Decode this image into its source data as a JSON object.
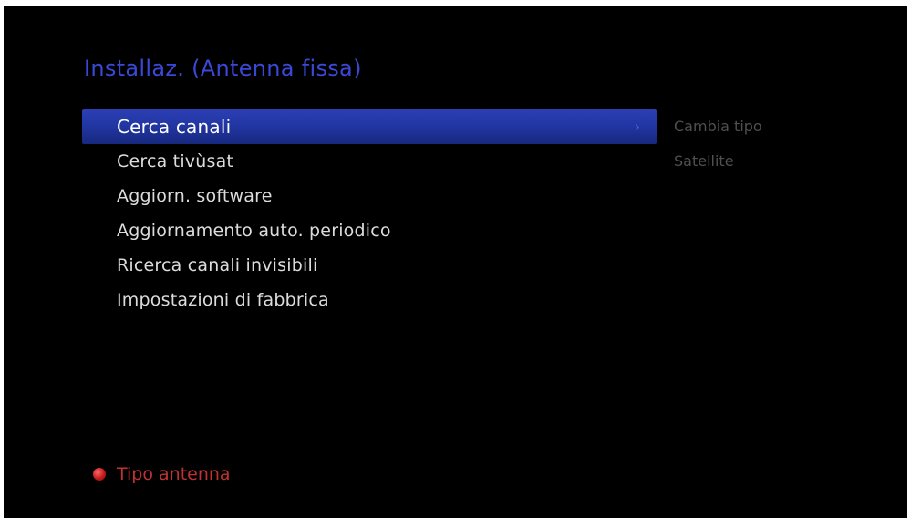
{
  "header": {
    "title": "Installaz. (Antenna fissa)"
  },
  "menu": {
    "items": [
      {
        "label": "Cerca canali",
        "selected": true
      },
      {
        "label": "Cerca tivùsat"
      },
      {
        "label": "Aggiorn. software"
      },
      {
        "label": "Aggiornamento auto. periodico"
      },
      {
        "label": "Ricerca canali invisibili"
      },
      {
        "label": "Impostazioni di fabbrica"
      }
    ],
    "chevron": "›"
  },
  "side_panel": {
    "lines": [
      "Cambia tipo",
      "Satellite"
    ]
  },
  "footer": {
    "hint_color": "red",
    "hint_label": "Tipo antenna"
  },
  "colors": {
    "background": "#000000",
    "title": "#3a48d8",
    "selection": "#2236a4",
    "red_button": "#c21a1a"
  }
}
